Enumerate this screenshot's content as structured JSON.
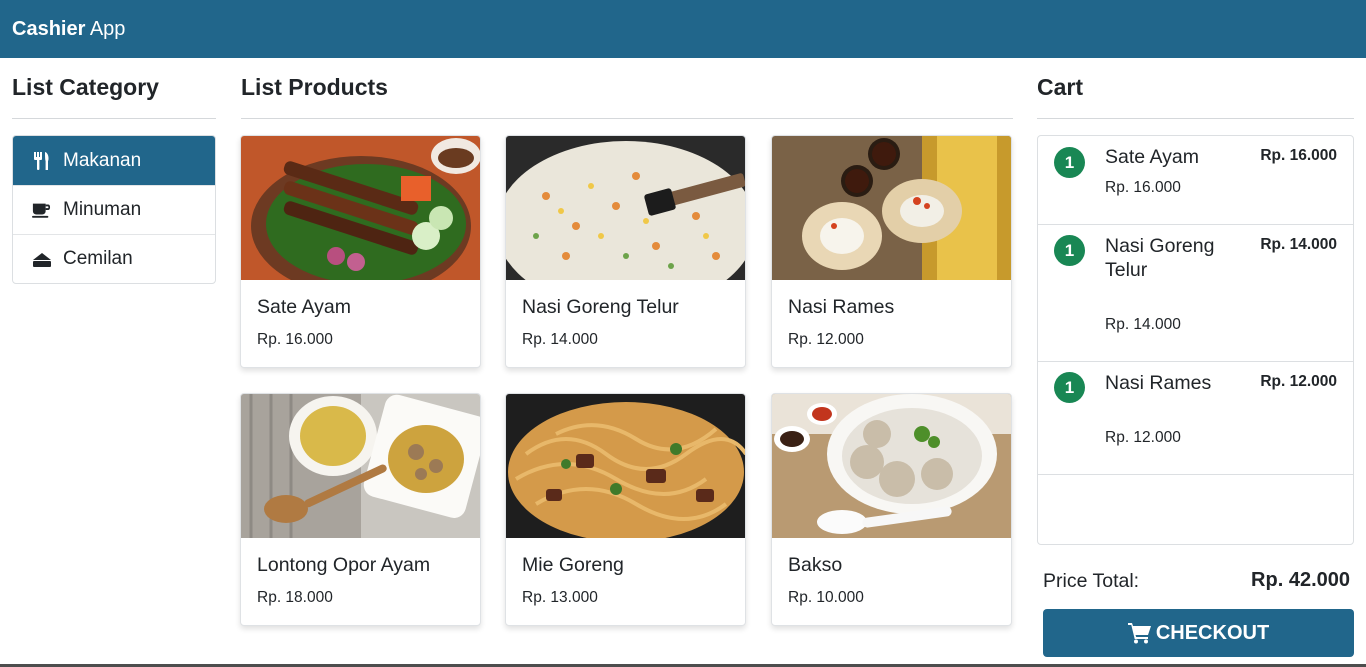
{
  "navbar": {
    "brand_bold": "Cashier",
    "brand_rest": " App"
  },
  "categories": {
    "title": "List Category",
    "items": [
      {
        "label": "Makanan",
        "icon": "utensils-icon",
        "active": true
      },
      {
        "label": "Minuman",
        "icon": "coffee-icon",
        "active": false
      },
      {
        "label": "Cemilan",
        "icon": "cake-icon",
        "active": false
      }
    ]
  },
  "products": {
    "title": "List Products",
    "items": [
      {
        "name": "Sate Ayam",
        "price": "Rp. 16.000",
        "image": "sate-ayam-photo"
      },
      {
        "name": "Nasi Goreng Telur",
        "price": "Rp. 14.000",
        "image": "nasi-goreng-photo"
      },
      {
        "name": "Nasi Rames",
        "price": "Rp. 12.000",
        "image": "nasi-rames-photo"
      },
      {
        "name": "Lontong Opor Ayam",
        "price": "Rp. 18.000",
        "image": "lontong-opor-photo"
      },
      {
        "name": "Mie Goreng",
        "price": "Rp. 13.000",
        "image": "mie-goreng-photo"
      },
      {
        "name": "Bakso",
        "price": "Rp. 10.000",
        "image": "bakso-photo"
      }
    ]
  },
  "cart": {
    "title": "Cart",
    "items": [
      {
        "qty": "1",
        "name": "Sate Ayam",
        "total": "Rp. 16.000",
        "unit_price": "Rp. 16.000"
      },
      {
        "qty": "1",
        "name": "Nasi Goreng Telur",
        "total": "Rp. 14.000",
        "unit_price": "Rp. 14.000"
      },
      {
        "qty": "1",
        "name": "Nasi Rames",
        "total": "Rp. 12.000",
        "unit_price": "Rp. 12.000"
      }
    ],
    "total_label": "Price Total:",
    "total_value": "Rp. 42.000",
    "checkout_label": "CHECKOUT"
  },
  "colors": {
    "primary": "#21668b",
    "badge": "#198754"
  }
}
